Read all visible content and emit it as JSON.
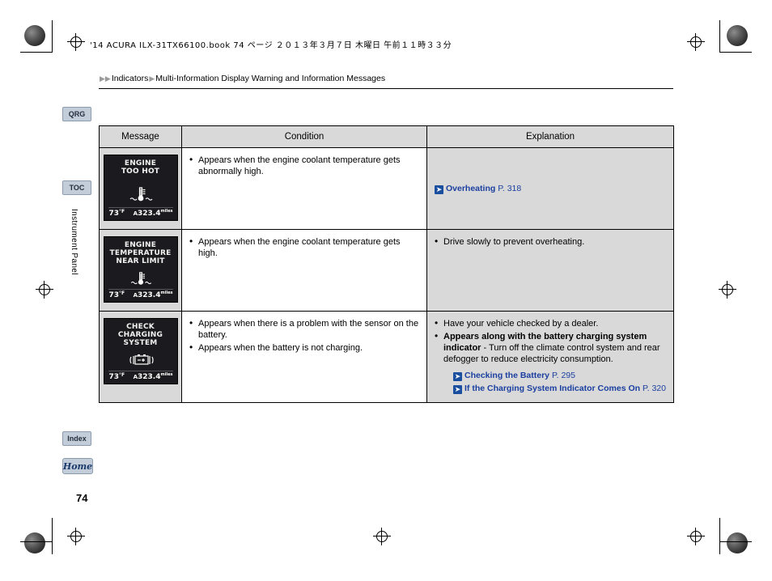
{
  "header": {
    "print_line": "'14 ACURA ILX-31TX66100.book 74 ページ ２０１３年３月７日 木曜日 午前１１時３３分",
    "breadcrumb": "Indicators",
    "breadcrumb2": "Multi-Information Display Warning and Information Messages",
    "page_number": "74"
  },
  "tabs": {
    "qrg": "QRG",
    "toc": "TOC",
    "index": "Index",
    "home": "Home",
    "side_label": "Instrument Panel"
  },
  "table": {
    "columns": [
      "Message",
      "Condition",
      "Explanation"
    ],
    "rows": [
      {
        "cluster": {
          "message_lines": [
            "ENGINE",
            "TOO HOT"
          ],
          "icon": "coolant-temperature-icon",
          "temp": "73",
          "temp_unit": "°F",
          "odo_prefix": "A",
          "odo": "323.4",
          "odo_unit": "miles"
        },
        "condition": [
          "Appears when the engine coolant temperature gets abnormally high."
        ],
        "explanation": [],
        "explanation_refs": [
          {
            "label": "Overheating",
            "page": "P. 318",
            "indent": false
          }
        ]
      },
      {
        "cluster": {
          "message_lines": [
            "ENGINE",
            "TEMPERATURE",
            "NEAR LIMIT"
          ],
          "icon": "coolant-temperature-icon",
          "temp": "73",
          "temp_unit": "°F",
          "odo_prefix": "A",
          "odo": "323.4",
          "odo_unit": "miles"
        },
        "condition": [
          "Appears when the engine coolant temperature gets high."
        ],
        "explanation": [
          "Drive slowly to prevent overheating."
        ],
        "explanation_refs": []
      },
      {
        "cluster": {
          "message_lines": [
            "CHECK",
            "CHARGING",
            "SYSTEM"
          ],
          "icon": "battery-icon",
          "temp": "73",
          "temp_unit": "°F",
          "odo_prefix": "A",
          "odo": "323.4",
          "odo_unit": "miles"
        },
        "condition": [
          "Appears when there is a problem with the sensor on the battery.",
          "Appears when the battery is not charging."
        ],
        "explanation": [
          "Have your vehicle checked by a dealer."
        ],
        "explanation_bold_intro": "Appears along with the battery charging system indicator",
        "explanation_bold_rest": " - Turn off the climate control system and rear defogger to reduce electricity consumption.",
        "explanation_refs": [
          {
            "label": "Checking the Battery",
            "page": "P. 295",
            "indent": true
          },
          {
            "label": "If the Charging System Indicator Comes On",
            "page": "P. 320",
            "indent": true
          }
        ]
      }
    ]
  },
  "colors": {
    "link": "#1a3fa0",
    "ref_box": "#1a4fa0",
    "tab_bg": "#c3cdd9",
    "header_bg": "#d9d9d9"
  }
}
